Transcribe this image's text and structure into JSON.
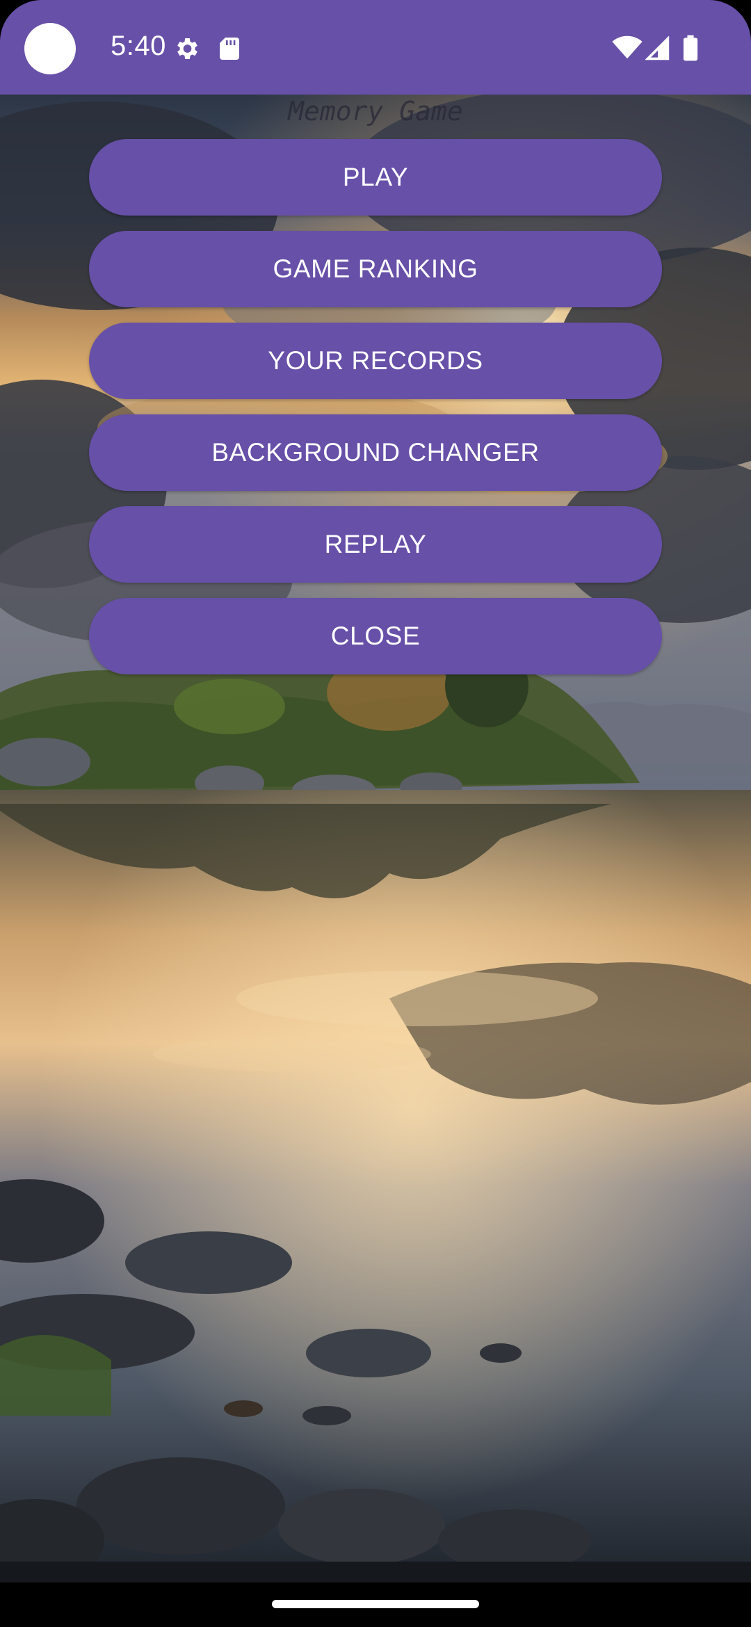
{
  "status_bar": {
    "time": "5:40",
    "left_icons": [
      "settings-gear-icon",
      "sd-card-icon"
    ],
    "right_icons": [
      "wifi-icon",
      "cell-signal-icon",
      "battery-icon"
    ],
    "color": "#6750a8"
  },
  "app": {
    "title": "Memory Game"
  },
  "menu": {
    "buttons": [
      {
        "label": "PLAY"
      },
      {
        "label": "GAME RANKING"
      },
      {
        "label": "YOUR RECORDS"
      },
      {
        "label": "BACKGROUND CHANGER"
      },
      {
        "label": "REPLAY"
      },
      {
        "label": "CLOSE"
      }
    ],
    "button_color": "#6750a8",
    "text_color": "#ffffff"
  },
  "background": {
    "scene": "lake-sunset-landscape"
  }
}
